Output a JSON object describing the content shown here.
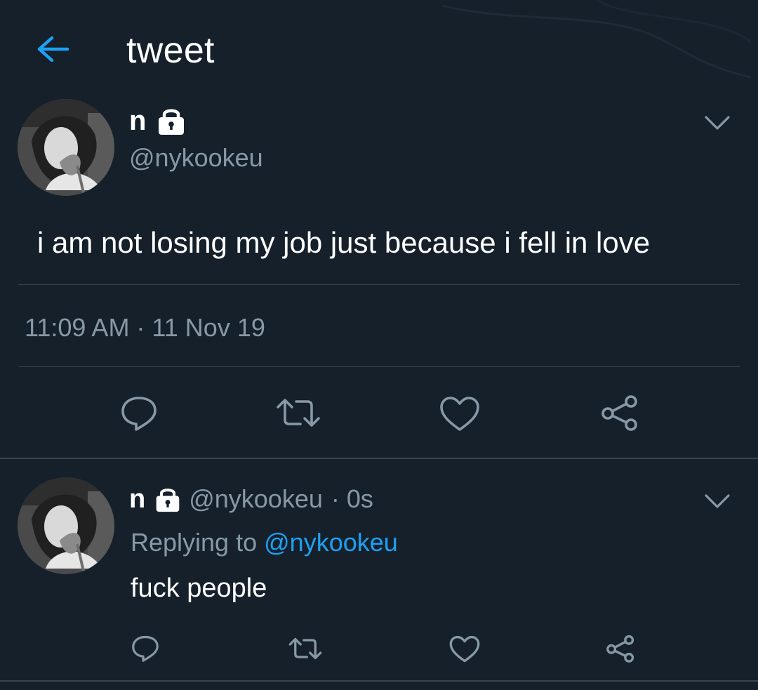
{
  "header": {
    "title": "tweet",
    "back_icon": "arrow-left-icon"
  },
  "colors": {
    "background": "#15202b",
    "accent": "#1da1f2",
    "secondary_text": "#8899a6",
    "divider": "#38444d"
  },
  "main_tweet": {
    "display_name": "n",
    "protected_icon": "lock-icon",
    "handle": "@nykookeu",
    "text": "i am not losing my job just because i fell in love",
    "timestamp": "11:09 AM · 11 Nov 19",
    "actions": [
      "reply-icon",
      "retweet-icon",
      "like-icon",
      "share-icon"
    ]
  },
  "reply_tweet": {
    "display_name": "n",
    "protected_icon": "lock-icon",
    "handle": "@nykookeu",
    "separator": "·",
    "time": "0s",
    "replying_label": "Replying to",
    "replying_mention": "@nykookeu",
    "text": "fuck people",
    "actions": [
      "reply-icon",
      "retweet-icon",
      "like-icon",
      "share-icon"
    ]
  }
}
